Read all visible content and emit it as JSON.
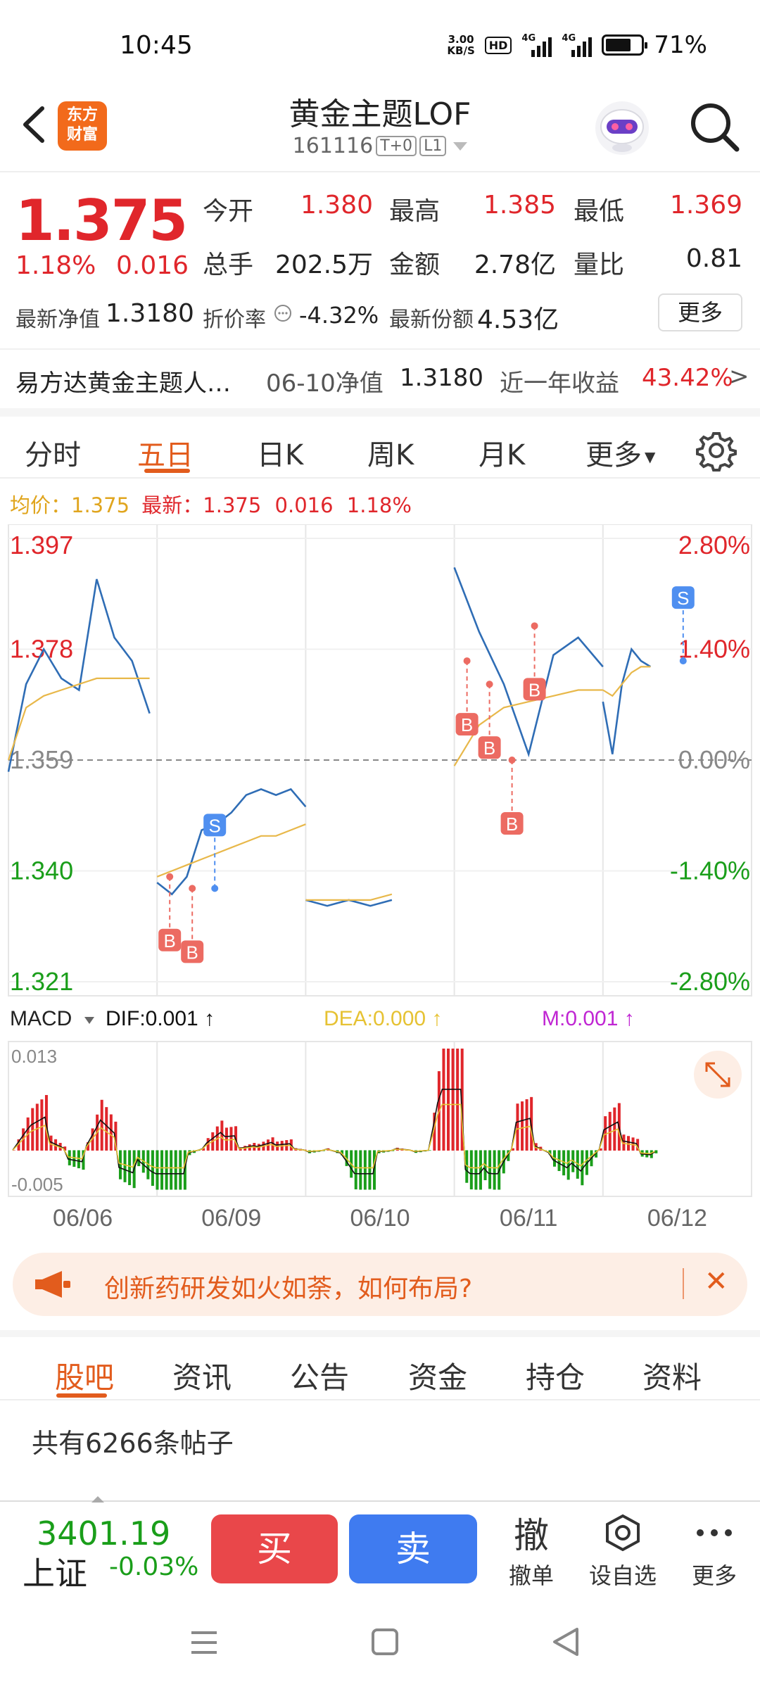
{
  "status_bar": {
    "time": "10:45",
    "net_speed_top": "3.00",
    "net_speed_bottom": "KB/S",
    "hd": "HD",
    "network_1": "4G",
    "network_2": "4G",
    "battery_level_pct": 71,
    "battery_text": "71%"
  },
  "header": {
    "logo_line1": "东方",
    "logo_line2": "财富",
    "title": "黄金主题LOF",
    "code": "161116",
    "tag1": "T+0",
    "tag2": "L1"
  },
  "quote": {
    "price": "1.375",
    "change_pct": "1.18%",
    "change_abs": "0.016",
    "open_label": "今开",
    "open_value": "1.380",
    "high_label": "最高",
    "high_value": "1.385",
    "low_label": "最低",
    "low_value": "1.369",
    "volume_label": "总手",
    "volume_value": "202.5万",
    "amount_label": "金额",
    "amount_value": "2.78亿",
    "ratio_label": "量比",
    "ratio_value": "0.81",
    "nav_label": "最新净值",
    "nav_value": "1.3180",
    "discount_label": "折价率",
    "discount_value": "-4.32%",
    "shares_label": "最新份额",
    "shares_value": "4.53亿",
    "more_label": "更多",
    "fund_name": "易方达黄金主题人…",
    "fund_nav_date": "06-10净值",
    "fund_nav_value": "1.3180",
    "fund_return_label": "近一年收益",
    "fund_return_value": "43.42%",
    "fund_arrow": ">"
  },
  "chart_tabs": [
    "分时",
    "五日",
    "日K",
    "周K",
    "月K",
    "更多"
  ],
  "chart_tabs_active": 1,
  "avg_info": {
    "avg_label": "均价：",
    "avg_value": "1.375",
    "latest_label": "最新：",
    "latest_value": "1.375",
    "latest_change": "0.016",
    "latest_pct": "1.18%"
  },
  "chart_data": {
    "type": "line",
    "title": "",
    "x_labels": [
      "06/06",
      "06/09",
      "06/10",
      "06/11",
      "06/12"
    ],
    "y_left_ticks": [
      "1.397",
      "1.378",
      "1.359",
      "1.340",
      "1.321"
    ],
    "y_right_ticks": [
      "2.80%",
      "1.40%",
      "0.00%",
      "-1.40%",
      "-2.80%"
    ],
    "ylim": [
      1.321,
      1.397
    ],
    "prev_close": 1.359,
    "series": [
      {
        "name": "价格",
        "color": "#2f6db5",
        "values": [
          1.357,
          1.372,
          1.378,
          1.373,
          1.371,
          1.39,
          1.38,
          1.376,
          1.367,
          1.338,
          1.336,
          1.339,
          1.347,
          1.348,
          1.35,
          1.353,
          1.354,
          1.353,
          1.354,
          1.351,
          1.335,
          1.334,
          1.335,
          1.334,
          1.335,
          1.392,
          1.381,
          1.372,
          1.36,
          1.377,
          1.38,
          1.375,
          1.369,
          1.36,
          1.372,
          1.378,
          1.376,
          1.375
        ]
      },
      {
        "name": "均价",
        "color": "#e8b84a",
        "values": [
          1.359,
          1.368,
          1.37,
          1.371,
          1.372,
          1.373,
          1.373,
          1.373,
          1.373,
          1.339,
          1.34,
          1.341,
          1.342,
          1.343,
          1.344,
          1.345,
          1.346,
          1.346,
          1.347,
          1.348,
          1.335,
          1.335,
          1.335,
          1.335,
          1.336,
          1.358,
          1.365,
          1.368,
          1.369,
          1.37,
          1.371,
          1.371,
          1.371,
          1.37,
          1.372,
          1.374,
          1.375,
          1.375
        ]
      }
    ],
    "markers": [
      {
        "label": "B",
        "type": "buy",
        "day": 1,
        "price": 1.339
      },
      {
        "label": "B",
        "type": "buy",
        "day": 1,
        "price": 1.337
      },
      {
        "label": "S",
        "type": "sell",
        "day": 1,
        "price": 1.337
      },
      {
        "label": "B",
        "type": "buy",
        "day": 3,
        "price": 1.382
      },
      {
        "label": "B",
        "type": "buy",
        "day": 3,
        "price": 1.376
      },
      {
        "label": "B",
        "type": "buy",
        "day": 3,
        "price": 1.372
      },
      {
        "label": "B",
        "type": "buy",
        "day": 3,
        "price": 1.359
      },
      {
        "label": "S",
        "type": "sell",
        "day": 4,
        "price": 1.376
      }
    ],
    "macd": {
      "label": "MACD",
      "dif_label": "DIF:0.001",
      "dea_label": "DEA:0.000",
      "m_label": "M:0.001",
      "y_top_label": "0.013",
      "y_bottom_label": "-0.005",
      "ylim": [
        -0.005,
        0.013
      ],
      "colors": {
        "dif": "#111111",
        "dea": "#e6c233",
        "m": "#c026d3",
        "up": "#e0262b",
        "down": "#1a9e1a"
      }
    }
  },
  "banner": {
    "text": "创新药研发如火如荼，如何布局?",
    "close": "✕"
  },
  "bottom_tabs": [
    "股吧",
    "资讯",
    "公告",
    "资金",
    "持仓",
    "资料"
  ],
  "bottom_tabs_active": 0,
  "post_count": "共有6266条帖子",
  "trade_bar": {
    "index_value": "3401.19",
    "index_name": "上证",
    "index_change": "-0.03%",
    "buy_label": "买",
    "sell_label": "卖",
    "cancel_icon": "撤",
    "cancel_label": "撤单",
    "watch_label": "设自选",
    "more_label": "更多"
  },
  "colors": {
    "accent": "#e25c1d",
    "up": "#e0262b",
    "down": "#1a9e1a",
    "buy": "#e9474a",
    "sell": "#3f7bf0"
  }
}
